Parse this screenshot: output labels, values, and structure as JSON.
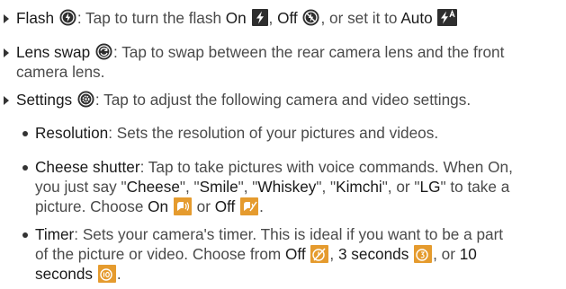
{
  "flash": {
    "term": "Flash",
    "desc_1": ": Tap to turn the flash ",
    "on": "On",
    "sep_1": ", ",
    "off": "Off",
    "desc_2": ", or set it to ",
    "auto": "Auto"
  },
  "lens_swap": {
    "term": "Lens swap",
    "desc_1": ": Tap to swap between the rear camera lens and the front",
    "desc_2": "camera lens."
  },
  "settings": {
    "term": "Settings",
    "desc": ": Tap to adjust the following camera and video settings."
  },
  "resolution": {
    "term": "Resolution",
    "desc": ": Sets the resolution of your pictures and videos."
  },
  "cheese_shutter": {
    "term": "Cheese shutter",
    "l1": ": Tap to take pictures with voice commands. When On,",
    "l2_a": "you just say \"",
    "w1": "Cheese",
    "q1": "\", \"",
    "w2": "Smile",
    "q2": "\", \"",
    "w3": "Whiskey",
    "q3": "\", \"",
    "w4": "Kimchi",
    "q4": "\", or \"",
    "w5": "LG",
    "q5": "\" to take a",
    "l3_a": "picture. Choose ",
    "on": "On",
    "l3_or": " or ",
    "off": "Off",
    "l3_end": "."
  },
  "timer": {
    "term": "Timer",
    "l1": ": Sets your camera's timer. This is ideal if you want to be a part",
    "l2_a": "of the picture or video. Choose from ",
    "off": "Off",
    "sep": ", ",
    "opt3": "3 seconds",
    "or": ", or ",
    "opt10": "10",
    "l3": "seconds",
    "end": "."
  },
  "icons": {
    "flash_icon": "flash-icon",
    "flash_on_icon": "flash-on-icon",
    "flash_off_icon": "flash-off-icon",
    "flash_auto_icon": "flash-auto-icon",
    "lens_swap_icon": "lens-swap-icon",
    "settings_icon": "settings-icon",
    "voice_on_icon": "voice-on-icon",
    "voice_off_icon": "voice-off-icon",
    "timer_off_icon": "timer-off-icon",
    "timer_3_icon": "timer-3-icon",
    "timer_10_icon": "timer-10-icon"
  },
  "colors": {
    "text": "#4a4a4a",
    "term": "#1a1a1a",
    "icon_circle": "#2e2e2e",
    "square_icon": "#e59b2e"
  }
}
